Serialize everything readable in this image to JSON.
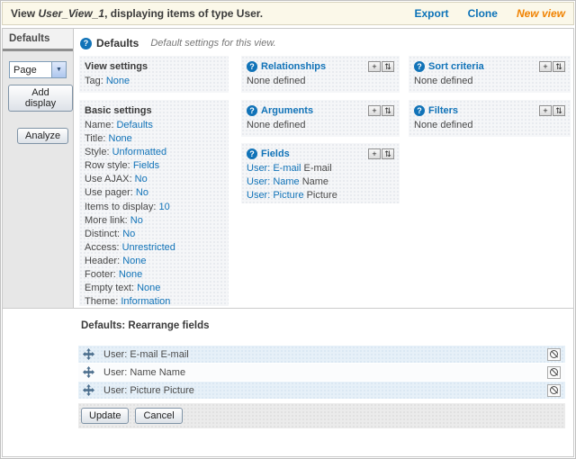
{
  "icons": {
    "help": "?",
    "add": "+",
    "rearrange": "⇅",
    "select_arrow": "▼"
  },
  "colors": {
    "link_blue": "#1173b8",
    "new_view_orange": "#f08200",
    "topbar_cream": "#fbf8e9",
    "row_blue": "#e6f0f8"
  },
  "header": {
    "title_prefix": "View",
    "view_name": "User_View_1",
    "title_suffix": ", displaying items of type User.",
    "links": [
      {
        "label": "Export"
      },
      {
        "label": "Clone"
      },
      {
        "label": "New view"
      }
    ]
  },
  "sidebar": {
    "tab": "Defaults",
    "display_select": {
      "value": "Page"
    },
    "add_display_button": "Add display",
    "analyze_button": "Analyze"
  },
  "main": {
    "heading": "Defaults",
    "subheading": "Default settings for this view.",
    "view_settings": {
      "title": "View settings",
      "items": [
        {
          "label": "Tag:",
          "value": "None"
        }
      ]
    },
    "basic_settings": {
      "title": "Basic settings",
      "items": [
        {
          "label": "Name:",
          "value": "Defaults"
        },
        {
          "label": "Title:",
          "value": "None"
        },
        {
          "label": "Style:",
          "value": "Unformatted"
        },
        {
          "label": "Row style:",
          "value": "Fields"
        },
        {
          "label": "Use AJAX:",
          "value": "No"
        },
        {
          "label": "Use pager:",
          "value": "No"
        },
        {
          "label": "Items to display:",
          "value": "10"
        },
        {
          "label": "More link:",
          "value": "No"
        },
        {
          "label": "Distinct:",
          "value": "No"
        },
        {
          "label": "Access:",
          "value": "Unrestricted"
        },
        {
          "label": "Header:",
          "value": "None"
        },
        {
          "label": "Footer:",
          "value": "None"
        },
        {
          "label": "Empty text:",
          "value": "None"
        },
        {
          "label": "Theme:",
          "value": "Information"
        }
      ]
    },
    "buckets": {
      "relationships": {
        "title": "Relationships",
        "empty": "None defined"
      },
      "arguments": {
        "title": "Arguments",
        "empty": "None defined"
      },
      "sort": {
        "title": "Sort criteria",
        "empty": "None defined"
      },
      "filters": {
        "title": "Filters",
        "empty": "None defined"
      },
      "fields": {
        "title": "Fields",
        "items": [
          {
            "link": "User: E-mail",
            "suffix": "E-mail"
          },
          {
            "link": "User: Name",
            "suffix": "Name"
          },
          {
            "link": "User: Picture",
            "suffix": "Picture"
          }
        ]
      }
    }
  },
  "rearrange": {
    "title": "Defaults: Rearrange fields",
    "rows": [
      "User: E-mail E-mail",
      "User: Name Name",
      "User: Picture Picture"
    ],
    "update_button": "Update",
    "cancel_button": "Cancel"
  }
}
